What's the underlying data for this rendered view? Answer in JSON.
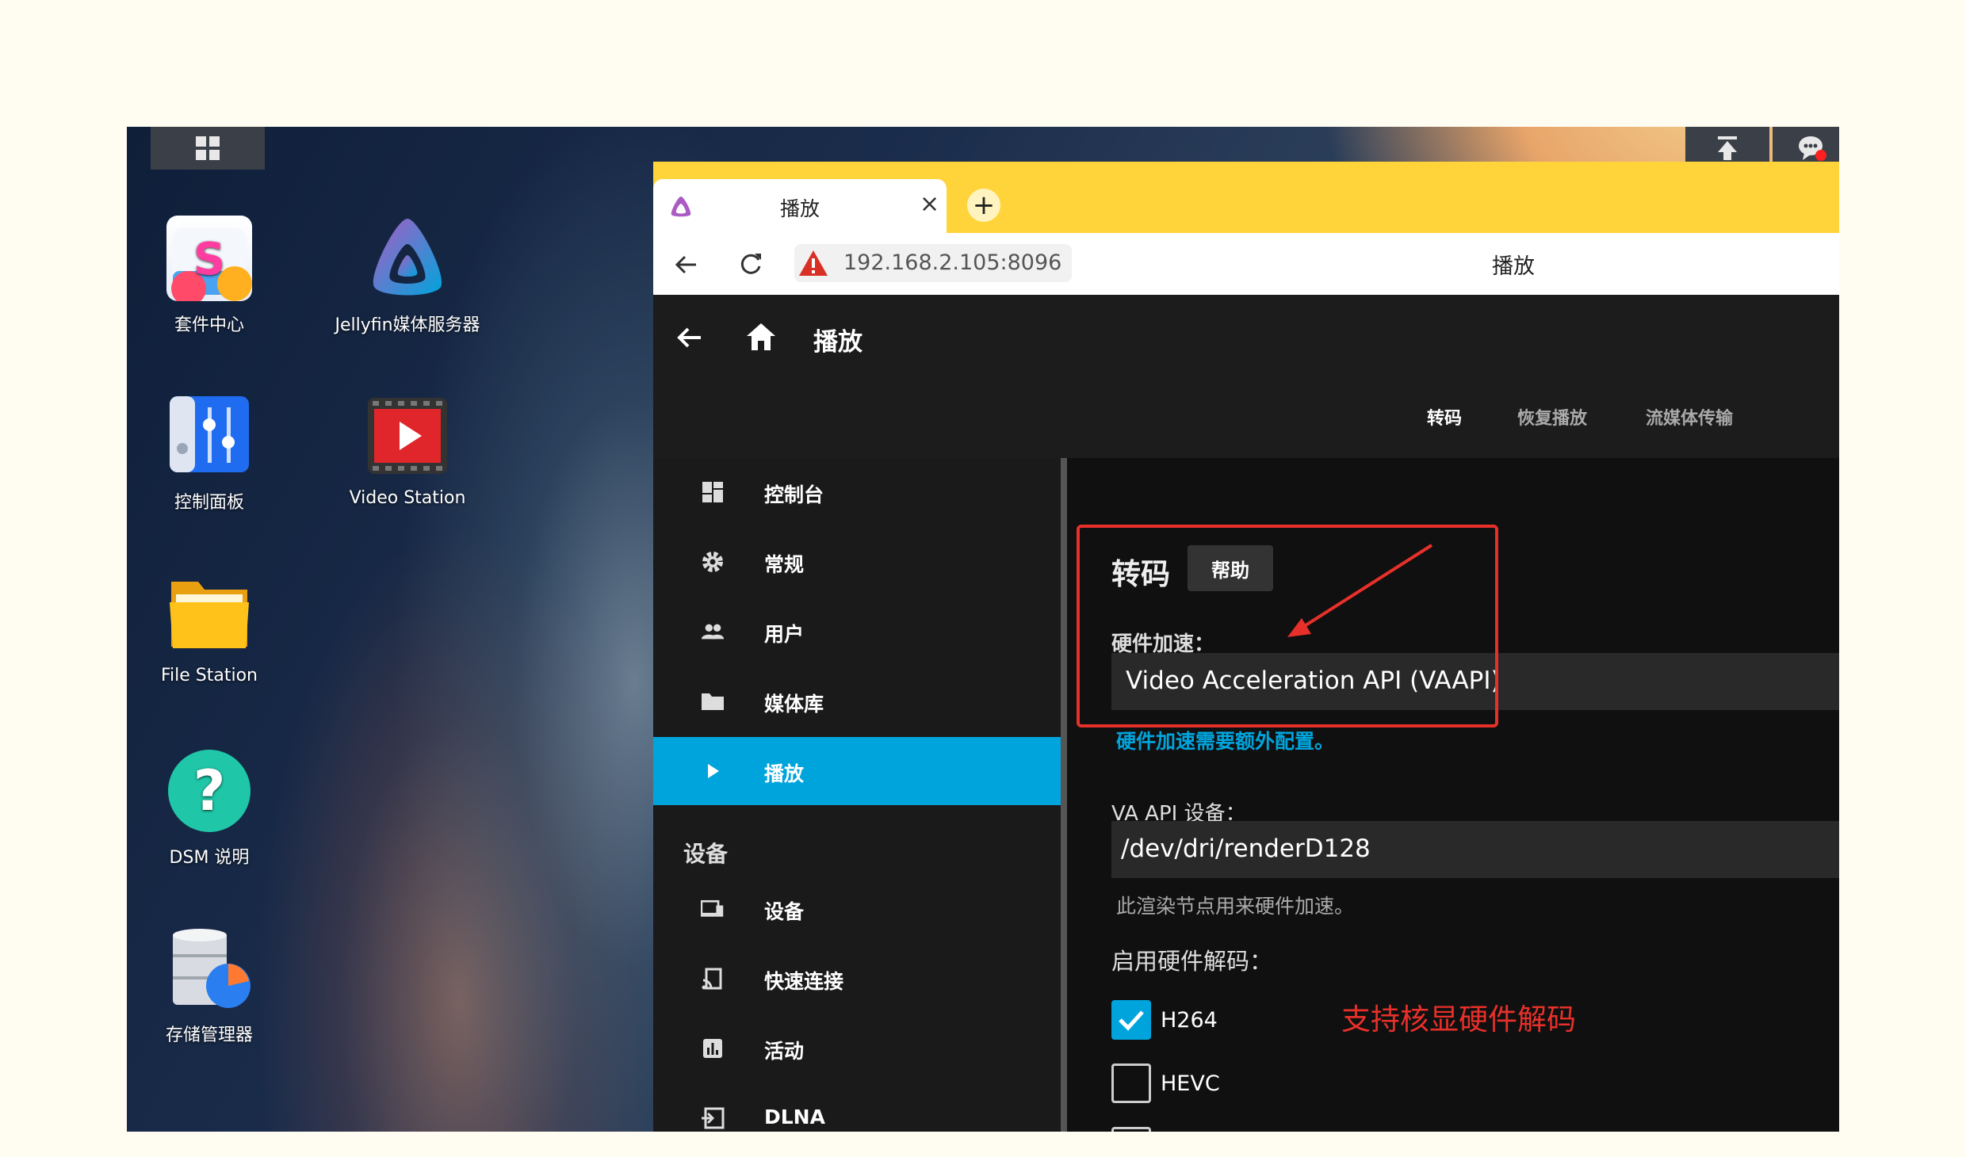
{
  "desktop": {
    "icons": [
      {
        "label": "套件中心"
      },
      {
        "label": "Jellyfin媒体服务器"
      },
      {
        "label": "控制面板"
      },
      {
        "label": "Video Station"
      },
      {
        "label": "File Station"
      },
      {
        "label": "DSM 说明"
      },
      {
        "label": "存储管理器"
      }
    ]
  },
  "browser": {
    "tab_title": "播放",
    "close_glyph": "×",
    "new_tab_glyph": "+",
    "address": "192.168.2.105:8096",
    "page_title": "播放"
  },
  "app": {
    "header_title": "播放",
    "header_tabs": [
      "转码",
      "恢复播放",
      "流媒体传输"
    ],
    "sidebar": {
      "items": [
        {
          "label": "控制台",
          "icon": "dashboard-icon"
        },
        {
          "label": "常规",
          "icon": "gear-icon"
        },
        {
          "label": "用户",
          "icon": "users-icon"
        },
        {
          "label": "媒体库",
          "icon": "folder-icon"
        },
        {
          "label": "播放",
          "icon": "play-icon",
          "active": true
        }
      ],
      "section_devices": "设备",
      "device_items": [
        {
          "label": "设备",
          "icon": "devices-icon"
        },
        {
          "label": "快速连接",
          "icon": "cast-icon"
        },
        {
          "label": "活动",
          "icon": "activity-icon"
        },
        {
          "label": "DLNA",
          "icon": "dlna-icon"
        }
      ]
    },
    "content": {
      "title": "转码",
      "help_button": "帮助",
      "hw_accel_label": "硬件加速：",
      "hw_accel_value": "Video Acceleration API (VAAPI)",
      "hw_accel_link": "硬件加速需要额外配置。",
      "vaapi_device_label": "VA API 设备：",
      "vaapi_device_value": "/dev/dri/renderD128",
      "vaapi_device_help": "此渲染节点用来硬件加速。",
      "hw_decode_label": "启用硬件解码：",
      "codecs": [
        {
          "label": "H264",
          "checked": true
        },
        {
          "label": "HEVC",
          "checked": false
        }
      ],
      "annotation": "支持核显硬件解码"
    }
  },
  "colors": {
    "accent": "#00a4dc",
    "annotation_red": "#e8302a",
    "tabstrip_yellow": "#ffd43b"
  }
}
